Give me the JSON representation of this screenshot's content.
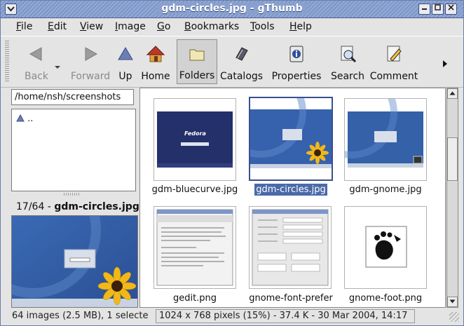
{
  "window": {
    "title": "gdm-circles.jpg - gThumb",
    "menu_icon": "down-arrow-icon",
    "controls": [
      "minimize-icon",
      "maximize-icon",
      "close-icon"
    ]
  },
  "menubar": {
    "items": [
      {
        "label": "File"
      },
      {
        "label": "Edit"
      },
      {
        "label": "View"
      },
      {
        "label": "Image"
      },
      {
        "label": "Go"
      },
      {
        "label": "Bookmarks"
      },
      {
        "label": "Tools"
      },
      {
        "label": "Help"
      }
    ]
  },
  "toolbar": {
    "back": {
      "label": "Back",
      "icon": "back-arrow-icon",
      "enabled": false
    },
    "forward": {
      "label": "Forward",
      "icon": "forward-arrow-icon",
      "enabled": false
    },
    "up": {
      "label": "Up",
      "icon": "up-arrow-icon"
    },
    "home": {
      "label": "Home",
      "icon": "home-icon"
    },
    "folders": {
      "label": "Folders",
      "icon": "folder-icon",
      "pressed": true
    },
    "catalogs": {
      "label": "Catalogs",
      "icon": "catalog-icon"
    },
    "properties": {
      "label": "Properties",
      "icon": "properties-icon"
    },
    "search": {
      "label": "Search",
      "icon": "search-icon"
    },
    "comment": {
      "label": "Comment",
      "icon": "comment-icon"
    },
    "more": "▸"
  },
  "sidebar": {
    "location": "/home/nsh/screenshots",
    "folder_items": [
      {
        "label": ".."
      }
    ],
    "image_info": {
      "position": "17/64 - ",
      "filename": "gdm-circles.jpg"
    }
  },
  "thumbnails": [
    {
      "filename": "gdm-bluecurve.jpg",
      "selected": false
    },
    {
      "filename": "gdm-circles.jpg",
      "selected": true
    },
    {
      "filename": "gdm-gnome.jpg",
      "selected": false
    },
    {
      "filename": "gedit.png",
      "selected": false
    },
    {
      "filename": "gnome-font-prefer",
      "selected": false
    },
    {
      "filename": "gnome-foot.png",
      "selected": false
    }
  ],
  "thumbnail_text": {
    "fedora": "Fedora"
  },
  "statusbar": {
    "summary": "64 images (2.5 MB), 1 selecte",
    "image_details": "1024 x 768 pixels (15%) - 37.4 K - 30 Mar 2004, 14:17"
  },
  "colors": {
    "selection": "#4a6aa8",
    "title_bar": "#889fcf",
    "desktop_blue": "#2f5fa8"
  }
}
